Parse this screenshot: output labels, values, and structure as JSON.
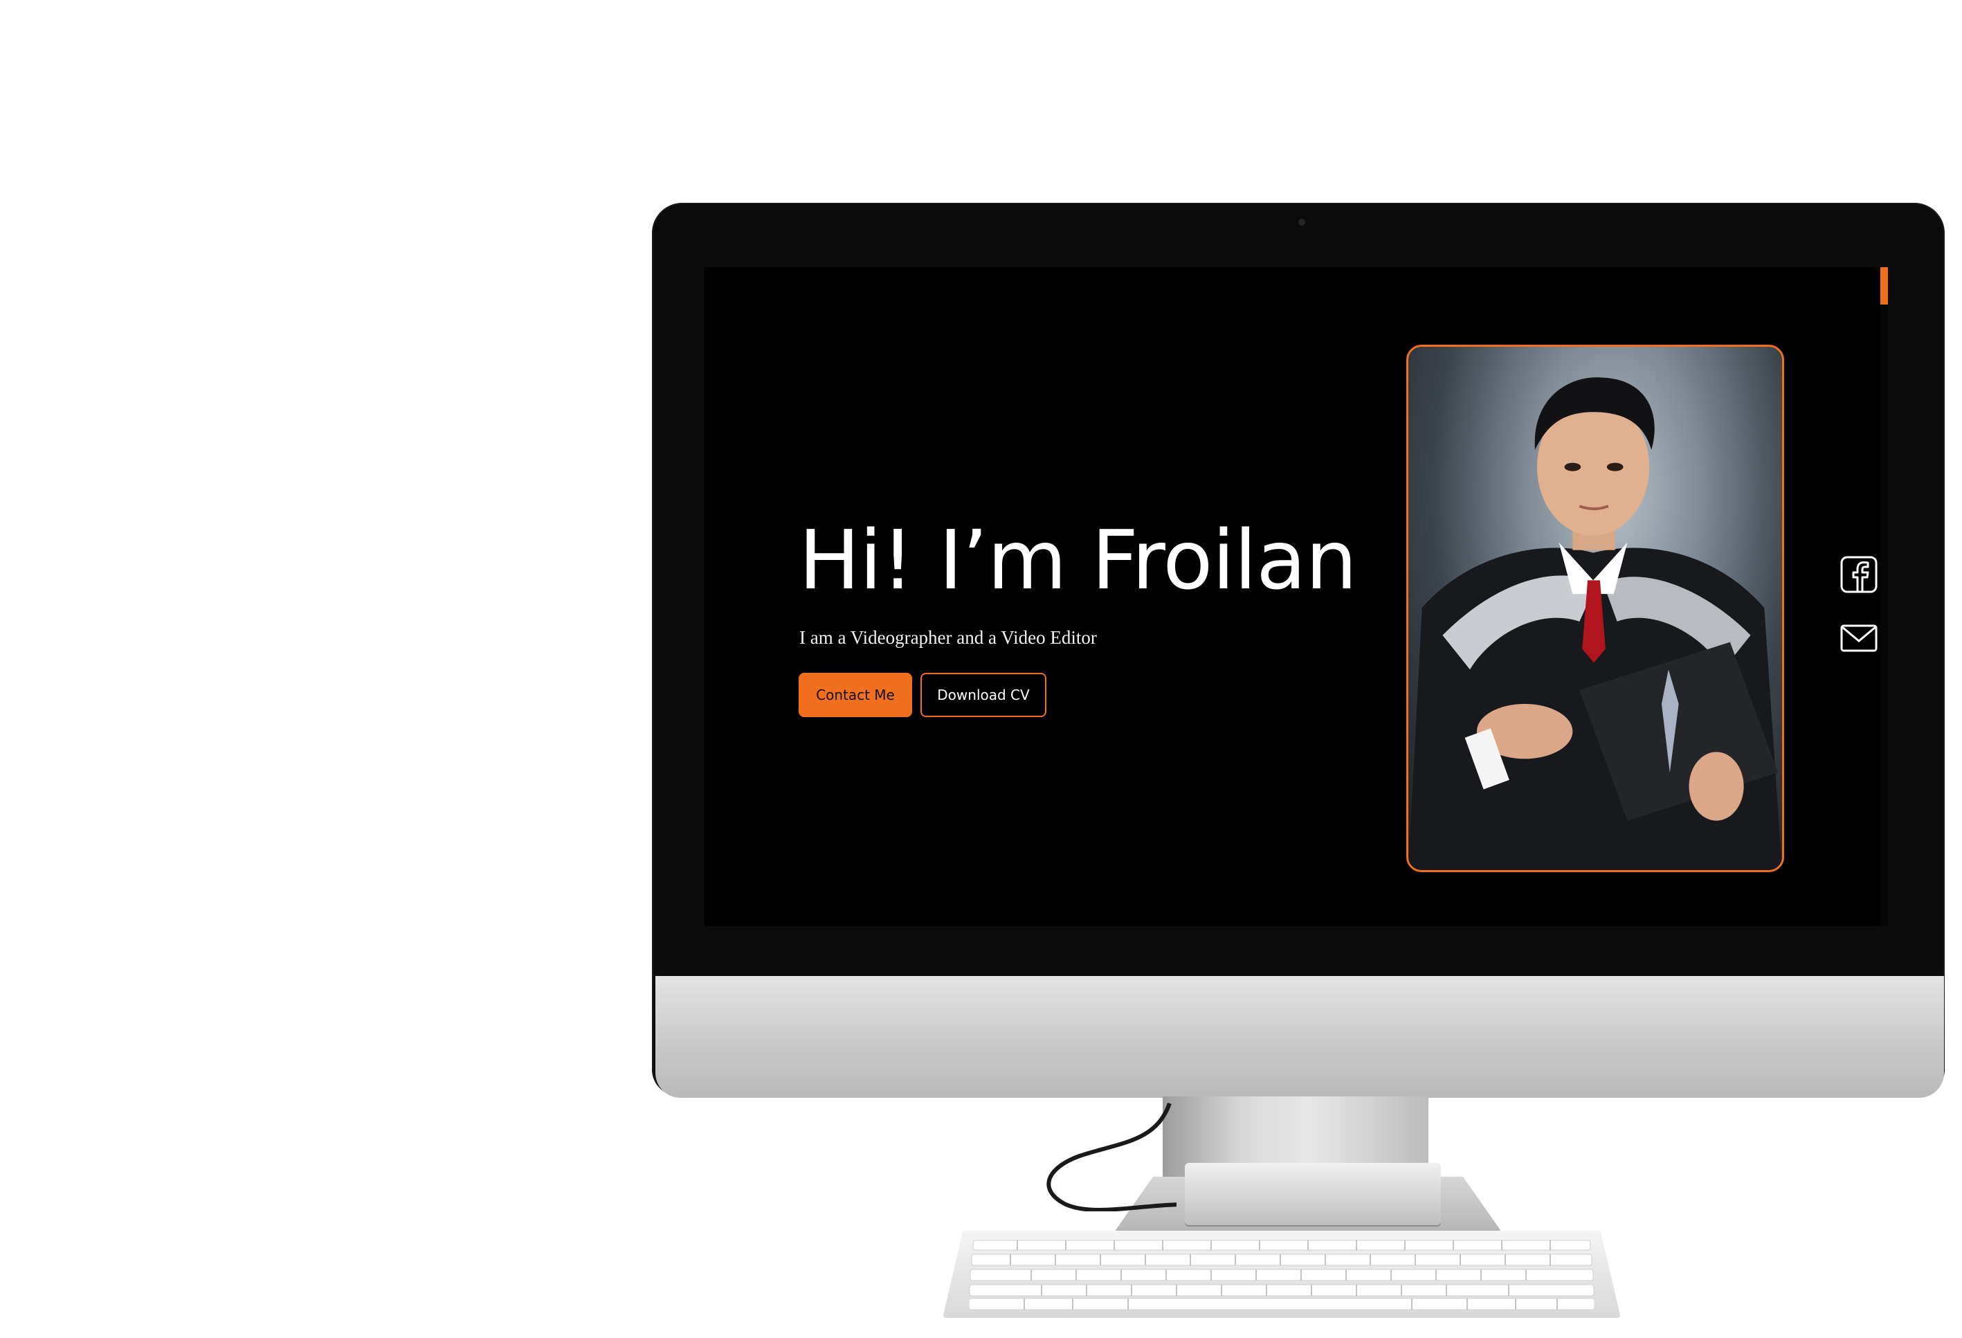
{
  "hero": {
    "title": "Hi! I’m Froilan",
    "subtitle": "I am a Videographer and a Video Editor"
  },
  "buttons": {
    "contact_label": "Contact Me",
    "download_label": "Download CV"
  },
  "social": {
    "facebook_icon": "facebook-icon",
    "email_icon": "mail-icon"
  },
  "colors": {
    "accent": "#f36f20",
    "background": "#000000",
    "text": "#ffffff"
  }
}
